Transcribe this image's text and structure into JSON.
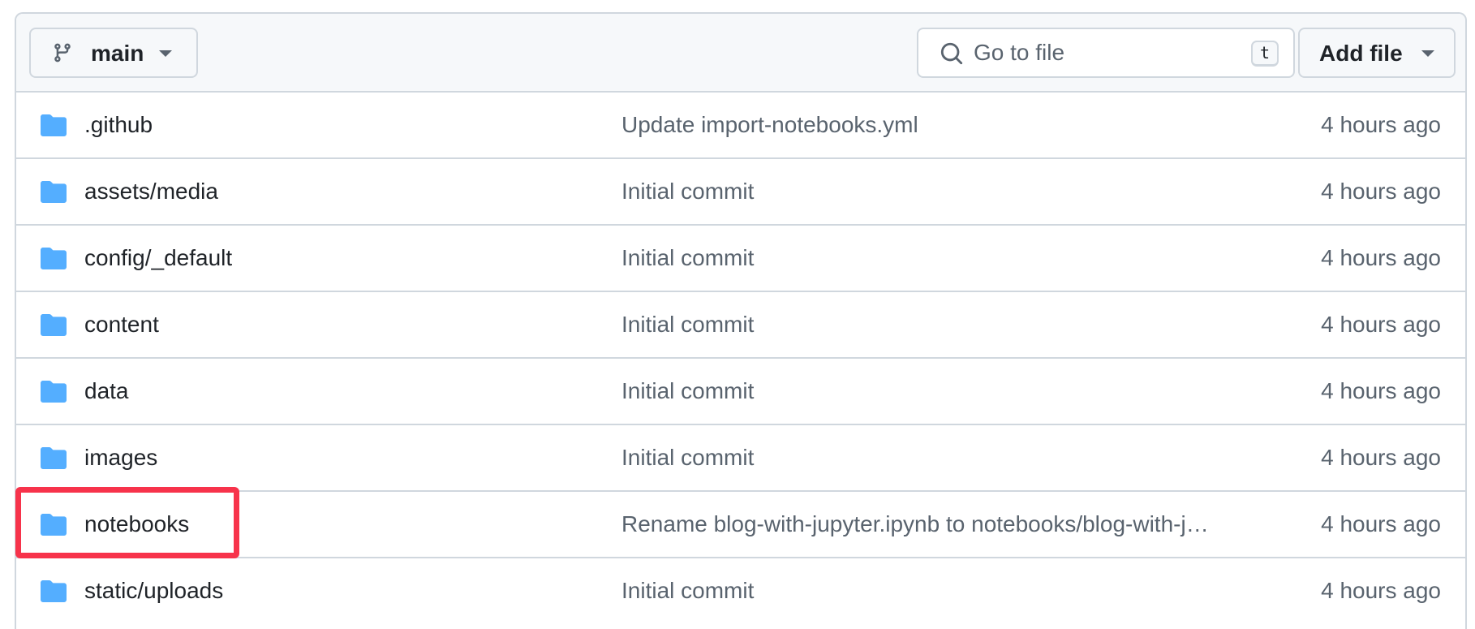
{
  "toolbar": {
    "branch_label": "main",
    "search_placeholder": "Go to file",
    "search_shortcut": "t",
    "add_file_label": "Add file"
  },
  "files": [
    {
      "name": ".github",
      "commit": "Update import-notebooks.yml",
      "age": "4 hours ago",
      "icon": "folder-icon"
    },
    {
      "name": "assets/media",
      "commit": "Initial commit",
      "age": "4 hours ago",
      "icon": "folder-icon"
    },
    {
      "name": "config/_default",
      "commit": "Initial commit",
      "age": "4 hours ago",
      "icon": "folder-icon"
    },
    {
      "name": "content",
      "commit": "Initial commit",
      "age": "4 hours ago",
      "icon": "folder-icon"
    },
    {
      "name": "data",
      "commit": "Initial commit",
      "age": "4 hours ago",
      "icon": "folder-icon"
    },
    {
      "name": "images",
      "commit": "Initial commit",
      "age": "4 hours ago",
      "icon": "folder-icon"
    },
    {
      "name": "notebooks",
      "commit": "Rename blog-with-jupyter.ipynb to notebooks/blog-with-j…",
      "age": "4 hours ago",
      "icon": "folder-icon"
    },
    {
      "name": "static/uploads",
      "commit": "Initial commit",
      "age": "4 hours ago",
      "icon": "folder-icon"
    }
  ],
  "colors": {
    "folder": "#54aeff",
    "highlight": "#f7334b",
    "border": "#d0d7de",
    "muted_text": "#59636e"
  }
}
